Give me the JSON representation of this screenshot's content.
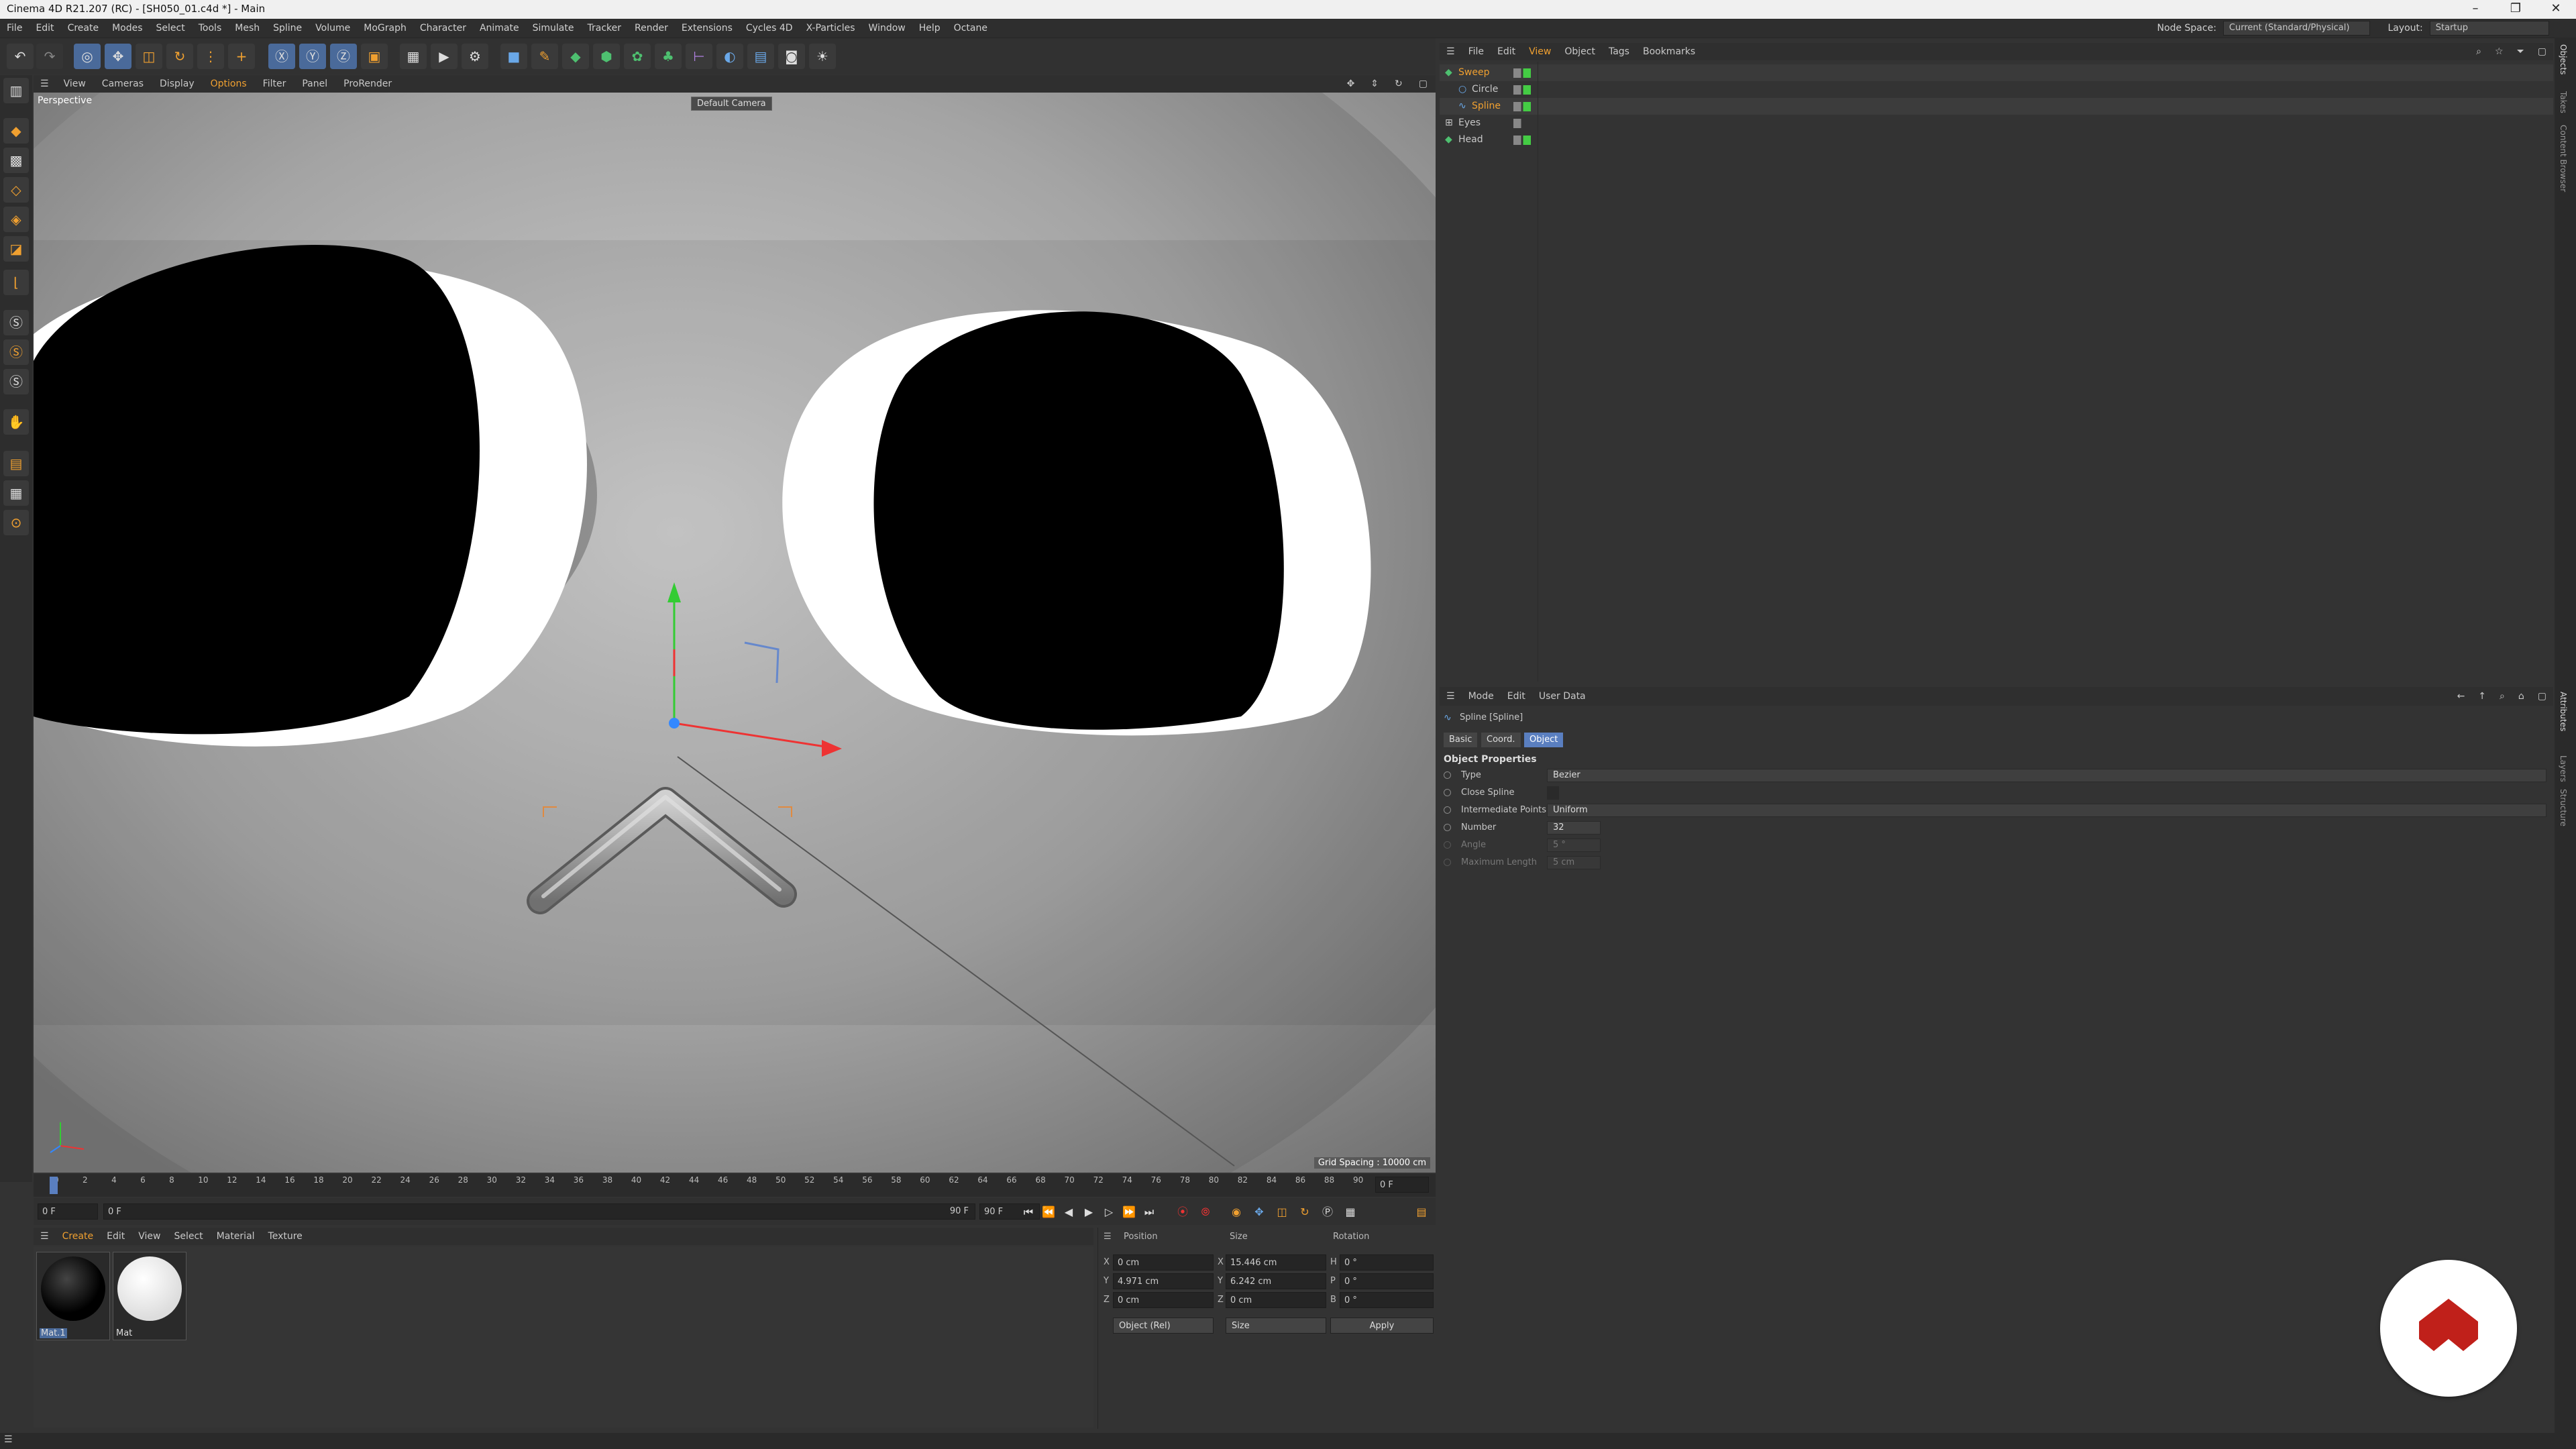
{
  "window": {
    "title": "Cinema 4D R21.207 (RC) - [SH050_01.c4d *] - Main",
    "controls": [
      "–",
      "❐",
      "✕"
    ]
  },
  "menubar": {
    "items": [
      "File",
      "Edit",
      "Create",
      "Modes",
      "Select",
      "Tools",
      "Mesh",
      "Spline",
      "Volume",
      "MoGraph",
      "Character",
      "Animate",
      "Simulate",
      "Tracker",
      "Render",
      "Extensions",
      "Cycles 4D",
      "X-Particles",
      "Window",
      "Help",
      "Octane"
    ],
    "node_space_label": "Node Space:",
    "node_space_value": "Current (Standard/Physical)",
    "layout_label": "Layout:",
    "layout_value": "Startup"
  },
  "viewport": {
    "menu": [
      "View",
      "Cameras",
      "Display",
      "Options",
      "Filter",
      "Panel",
      "ProRender"
    ],
    "label": "Perspective",
    "camera": "Default Camera",
    "grid_spacing": "Grid Spacing : 10000 cm"
  },
  "timeline": {
    "ticks": [
      "0",
      "2",
      "4",
      "6",
      "8",
      "10",
      "12",
      "14",
      "16",
      "18",
      "20",
      "22",
      "24",
      "26",
      "28",
      "30",
      "32",
      "34",
      "36",
      "38",
      "40",
      "42",
      "44",
      "46",
      "48",
      "50",
      "52",
      "54",
      "56",
      "58",
      "60",
      "62",
      "64",
      "66",
      "68",
      "70",
      "72",
      "74",
      "76",
      "78",
      "80",
      "82",
      "84",
      "86",
      "88",
      "90"
    ],
    "current_frame": "0 F"
  },
  "transport": {
    "start": "0 F",
    "current": "0 F",
    "end_a": "90 F",
    "end_b": "90 F"
  },
  "materials": {
    "menu": [
      "Create",
      "Edit",
      "View",
      "Select",
      "Material",
      "Texture"
    ],
    "items": [
      {
        "name": "Mat.1",
        "color": "#000000"
      },
      {
        "name": "Mat",
        "color": "#ffffff"
      }
    ]
  },
  "coordinates": {
    "headers": [
      "Position",
      "Size",
      "Rotation"
    ],
    "rows": [
      {
        "axis": "X",
        "pos": "0 cm",
        "size_axis": "X",
        "size": "15.446 cm",
        "rot_axis": "H",
        "rot": "0 °"
      },
      {
        "axis": "Y",
        "pos": "4.971 cm",
        "size_axis": "Y",
        "size": "6.242 cm",
        "rot_axis": "P",
        "rot": "0 °"
      },
      {
        "axis": "Z",
        "pos": "0 cm",
        "size_axis": "Z",
        "size": "0 cm",
        "rot_axis": "B",
        "rot": "0 °"
      }
    ],
    "mode": "Object (Rel)",
    "size_mode": "Size",
    "apply": "Apply"
  },
  "objects": {
    "menu": [
      "File",
      "Edit",
      "View",
      "Object",
      "Tags",
      "Bookmarks"
    ],
    "tree": [
      {
        "name": "Sweep",
        "indent": 0,
        "color": "#f0a030"
      },
      {
        "name": "Circle",
        "indent": 1,
        "color": "#c8c8c8"
      },
      {
        "name": "Spline",
        "indent": 1,
        "color": "#f0a030"
      },
      {
        "name": "Eyes",
        "indent": 0,
        "color": "#c8c8c8"
      },
      {
        "name": "Head",
        "indent": 0,
        "color": "#c8c8c8"
      }
    ]
  },
  "attributes": {
    "menu": [
      "Mode",
      "Edit",
      "User Data"
    ],
    "object_title": "Spline [Spline]",
    "tabs": [
      "Basic",
      "Coord.",
      "Object"
    ],
    "active_tab": "Object",
    "section": "Object Properties",
    "props": [
      {
        "label": "Type",
        "value": "Bezier",
        "kind": "dropdown"
      },
      {
        "label": "Close Spline",
        "value": "",
        "kind": "checkbox"
      },
      {
        "label": "Intermediate Points",
        "value": "Uniform",
        "kind": "dropdown"
      },
      {
        "label": "Number",
        "value": "32",
        "kind": "number"
      },
      {
        "label": "Angle",
        "value": "5 °",
        "kind": "number-dim"
      },
      {
        "label": "Maximum Length",
        "value": "5 cm",
        "kind": "number-dim"
      }
    ]
  },
  "right_strip": [
    "Objects",
    "Takes",
    "Content Browser",
    "Attributes",
    "Layers",
    "Structure"
  ]
}
